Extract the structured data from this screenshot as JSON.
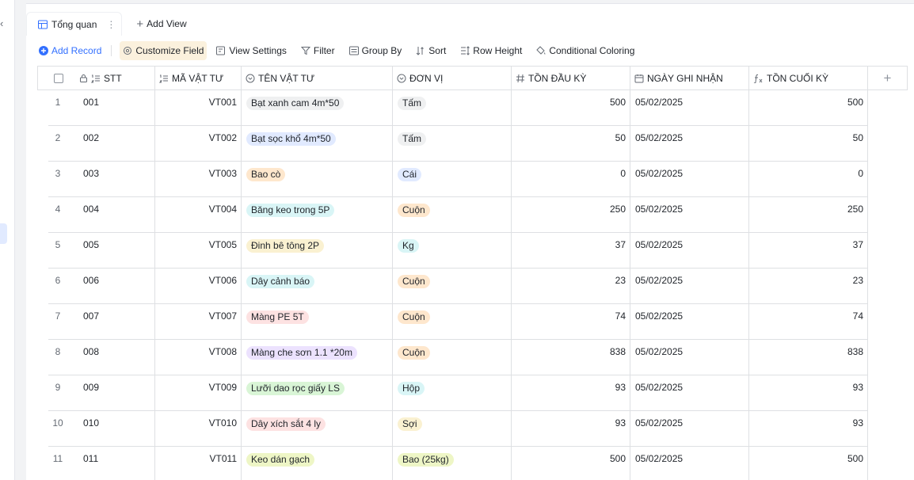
{
  "view_tabs": [
    {
      "label": "Tổng quan",
      "icon": "grid-view-icon",
      "active": true
    }
  ],
  "add_view_label": "Add View",
  "toolbar": {
    "add_record": "Add Record",
    "customize_field": "Customize Field",
    "view_settings": "View Settings",
    "filter": "Filter",
    "group_by": "Group By",
    "sort": "Sort",
    "row_height": "Row Height",
    "conditional_coloring": "Conditional Coloring"
  },
  "colors": {
    "accent": "#3370ff",
    "border": "#dee0e3",
    "tag_pink": "#fde2e2",
    "tag_grey": "#eff0f1",
    "tag_orange": "#fee7cd",
    "tag_blue": "#e1eaff",
    "tag_cyan": "#d9f5f6",
    "tag_yellow": "#faf1d1",
    "tag_green": "#d9f5d6",
    "tag_purple": "#ece2fe",
    "tag_lime": "#eef6c6"
  },
  "columns": [
    {
      "key": "stt",
      "label": "STT",
      "icon": "autonumber-icon"
    },
    {
      "key": "ma",
      "label": "MÃ VẬT TƯ",
      "icon": "formula-list-icon"
    },
    {
      "key": "ten",
      "label": "TÊN VẬT TƯ",
      "icon": "single-select-icon"
    },
    {
      "key": "dv",
      "label": "ĐƠN VỊ",
      "icon": "single-select-icon"
    },
    {
      "key": "ton_dau",
      "label": "TỒN ĐẦU KỲ",
      "icon": "number-icon"
    },
    {
      "key": "ngay",
      "label": "NGÀY GHI NHẬN",
      "icon": "date-icon"
    },
    {
      "key": "ton_cuoi",
      "label": "TỒN CUỐI KỲ",
      "icon": "formula-icon"
    }
  ],
  "rows": [
    {
      "index": "1",
      "stt": "001",
      "ma": "VT001",
      "ten": "Bạt xanh cam 4m*50",
      "ten_color": "tag_grey",
      "dv": "Tấm",
      "dv_color": "tag_grey",
      "ton_dau": "500",
      "ngay": "05/02/2025",
      "ton_cuoi": "500"
    },
    {
      "index": "2",
      "stt": "002",
      "ma": "VT002",
      "ten": "Bạt sọc khổ 4m*50",
      "ten_color": "tag_blue",
      "dv": "Tấm",
      "dv_color": "tag_grey",
      "ton_dau": "50",
      "ngay": "05/02/2025",
      "ton_cuoi": "50"
    },
    {
      "index": "3",
      "stt": "003",
      "ma": "VT003",
      "ten": "Bao cò",
      "ten_color": "tag_orange",
      "dv": "Cái",
      "dv_color": "tag_blue",
      "ton_dau": "0",
      "ngay": "05/02/2025",
      "ton_cuoi": "0"
    },
    {
      "index": "4",
      "stt": "004",
      "ma": "VT004",
      "ten": "Băng keo trong 5P",
      "ten_color": "tag_cyan",
      "dv": "Cuộn",
      "dv_color": "tag_orange",
      "ton_dau": "250",
      "ngay": "05/02/2025",
      "ton_cuoi": "250"
    },
    {
      "index": "5",
      "stt": "005",
      "ma": "VT005",
      "ten": "Đinh bê tông 2P",
      "ten_color": "tag_yellow",
      "dv": "Kg",
      "dv_color": "tag_cyan",
      "ton_dau": "37",
      "ngay": "05/02/2025",
      "ton_cuoi": "37"
    },
    {
      "index": "6",
      "stt": "006",
      "ma": "VT006",
      "ten": "Dây cảnh báo",
      "ten_color": "tag_cyan",
      "dv": "Cuộn",
      "dv_color": "tag_orange",
      "ton_dau": "23",
      "ngay": "05/02/2025",
      "ton_cuoi": "23"
    },
    {
      "index": "7",
      "stt": "007",
      "ma": "VT007",
      "ten": "Màng PE 5T",
      "ten_color": "tag_pink",
      "dv": "Cuộn",
      "dv_color": "tag_orange",
      "ton_dau": "74",
      "ngay": "05/02/2025",
      "ton_cuoi": "74"
    },
    {
      "index": "8",
      "stt": "008",
      "ma": "VT008",
      "ten": "Màng che sơn 1.1 *20m",
      "ten_color": "tag_purple",
      "dv": "Cuộn",
      "dv_color": "tag_orange",
      "ton_dau": "838",
      "ngay": "05/02/2025",
      "ton_cuoi": "838"
    },
    {
      "index": "9",
      "stt": "009",
      "ma": "VT009",
      "ten": "Lưỡi dao rọc giấy LS",
      "ten_color": "tag_green",
      "dv": "Hộp",
      "dv_color": "tag_cyan",
      "ton_dau": "93",
      "ngay": "05/02/2025",
      "ton_cuoi": "93"
    },
    {
      "index": "10",
      "stt": "010",
      "ma": "VT010",
      "ten": "Dây xích sắt 4 ly",
      "ten_color": "tag_pink",
      "dv": "Sợi",
      "dv_color": "tag_yellow",
      "ton_dau": "93",
      "ngay": "05/02/2025",
      "ton_cuoi": "93"
    },
    {
      "index": "11",
      "stt": "011",
      "ma": "VT011",
      "ten": "Keo dán gạch",
      "ten_color": "tag_lime",
      "dv": "Bao (25kg)",
      "dv_color": "tag_lime",
      "ton_dau": "500",
      "ngay": "05/02/2025",
      "ton_cuoi": "500"
    }
  ]
}
